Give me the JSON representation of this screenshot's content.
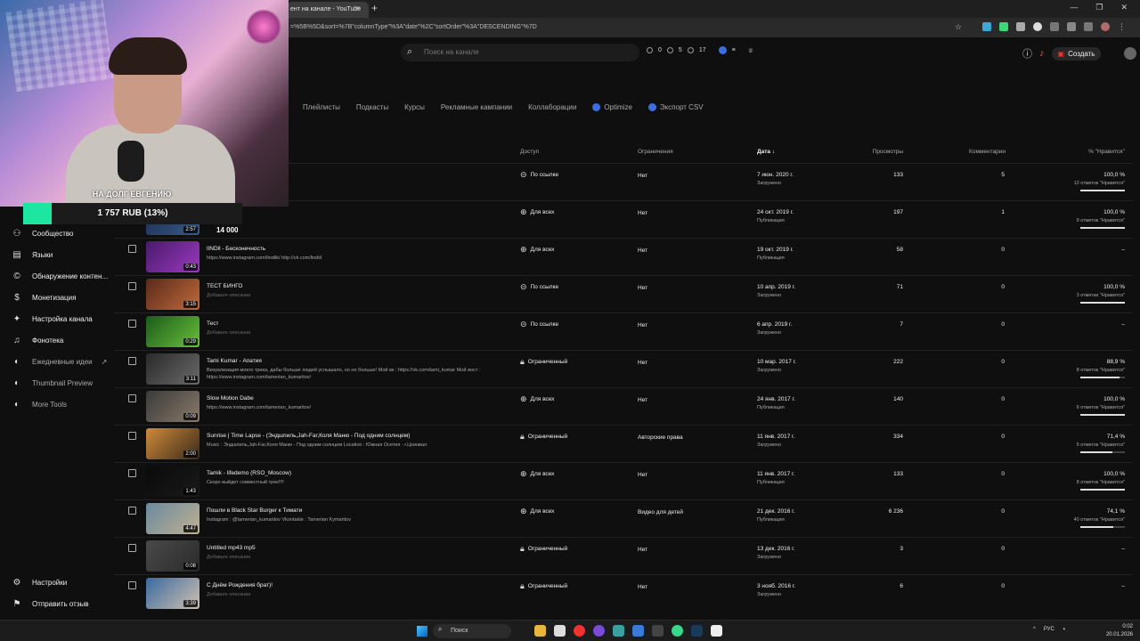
{
  "browser": {
    "tab_title": "ент на канале - YouTube",
    "tab_close": "×",
    "new_tab": "+",
    "url": "=%5B%5D&sort=%7B\"columnType\"%3A\"date\"%2C\"sortOrder\"%3A\"DESCENDING\"%7D"
  },
  "header": {
    "search_placeholder": "Поиск на канале",
    "stats": [
      "0",
      "5",
      "17"
    ],
    "create_label": "Создать"
  },
  "tabs": [
    {
      "label": "Плейлисты"
    },
    {
      "label": "Подкасты"
    },
    {
      "label": "Курсы"
    },
    {
      "label": "Рекламные кампании"
    },
    {
      "label": "Коллаборации"
    },
    {
      "label": "Optimize"
    },
    {
      "label": "Экспорт CSV"
    }
  ],
  "sidebar": {
    "items": [
      {
        "label": "Сообщество",
        "icon": "community-icon"
      },
      {
        "label": "Языки",
        "icon": "subtitles-icon"
      },
      {
        "label": "Обнаружение контен...",
        "icon": "copyright-icon"
      },
      {
        "label": "Монетизация",
        "icon": "dollar-icon"
      },
      {
        "label": "Настройка канала",
        "icon": "magic-wand-icon"
      },
      {
        "label": "Фонотека",
        "icon": "music-library-icon"
      },
      {
        "label": "Ежедневные идеи",
        "icon": "ideas-icon"
      },
      {
        "label": "Thumbnail Preview",
        "icon": "thumbnail-icon"
      },
      {
        "label": "More Tools",
        "icon": "tools-icon"
      }
    ],
    "settings_label": "Настройки",
    "feedback_label": "Отправить отзыв"
  },
  "table": {
    "headers": {
      "access": "Доступ",
      "restrictions": "Ограничения",
      "date": "Дата",
      "views": "Просмотры",
      "comments": "Комментарии",
      "likes": "% \"Нравится\""
    },
    "rows": [
      {
        "title": "",
        "desc": "",
        "desc_ph": false,
        "duration": "",
        "access": "По ссылке",
        "access_icon": "link",
        "restriction": "Нет",
        "date": "7 июн. 2020 г.",
        "date_sub": "Загружено",
        "views": "133",
        "comments": "5",
        "likes": "100,0 %",
        "likes_sub": "12 отметок \"Нравится\"",
        "likes_pct": 100,
        "thumb": [
          "#333",
          "#555"
        ]
      },
      {
        "title": "",
        "desc": "",
        "desc_ph": false,
        "duration": "2:57",
        "access": "Для всех",
        "access_icon": "globe",
        "restriction": "Нет",
        "date": "24 окт. 2019 г.",
        "date_sub": "Публикация",
        "views": "197",
        "comments": "1",
        "likes": "100,0 %",
        "likes_sub": "9 отметок \"Нравится\"",
        "likes_pct": 100,
        "thumb": [
          "#1a2a4a",
          "#3a5a8a"
        ]
      },
      {
        "title": "lINDll - Бесконечность",
        "desc": "https://www.instagram.com/lindilk/ http://vk.com/lindiil",
        "desc_ph": false,
        "duration": "0:43",
        "access": "Для всех",
        "access_icon": "globe",
        "restriction": "Нет",
        "date": "19 окт. 2019 г.",
        "date_sub": "Публикация",
        "views": "58",
        "comments": "0",
        "likes": "–",
        "likes_sub": "",
        "likes_pct": null,
        "thumb": [
          "#4a1a6a",
          "#9a3ac0"
        ]
      },
      {
        "title": "ТЕСТ БИНГО",
        "desc": "Добавьте описание",
        "desc_ph": true,
        "duration": "3:15",
        "access": "По ссылке",
        "access_icon": "link",
        "restriction": "Нет",
        "date": "10 апр. 2019 г.",
        "date_sub": "Загружено",
        "views": "71",
        "comments": "0",
        "likes": "100,0 %",
        "likes_sub": "3 отметки \"Нравится\"",
        "likes_pct": 100,
        "thumb": [
          "#5a2a1a",
          "#c06a3a"
        ]
      },
      {
        "title": "Тест",
        "desc": "Добавьте описание",
        "desc_ph": true,
        "duration": "0:29",
        "access": "По ссылке",
        "access_icon": "link",
        "restriction": "Нет",
        "date": "6 апр. 2019 г.",
        "date_sub": "Загружено",
        "views": "7",
        "comments": "0",
        "likes": "–",
        "likes_sub": "",
        "likes_pct": null,
        "thumb": [
          "#1a5a1a",
          "#6ac03a"
        ]
      },
      {
        "title": "Tami Kumar - Апатия",
        "desc": "Визуализация моего трека, дабы больше людей услышало, но не больше! Мой вк : https://vk.com/tami_kumar Мой инст : https://www.instagram.com/tamerian_kumaritov/",
        "desc_ph": false,
        "duration": "3:11",
        "access": "Ограниченный",
        "access_icon": "lock",
        "restriction": "Нет",
        "date": "10 мар. 2017 г.",
        "date_sub": "Загружено",
        "views": "222",
        "comments": "0",
        "likes": "88,9 %",
        "likes_sub": "8 отметок \"Нравится\"",
        "likes_pct": 88.9,
        "thumb": [
          "#2a2a2a",
          "#6a6a6a"
        ]
      },
      {
        "title": "Slow Motion Dabe",
        "desc": "https://www.instagram.com/tamerian_kumaritov/",
        "desc_ph": false,
        "duration": "0:09",
        "access": "Для всех",
        "access_icon": "globe",
        "restriction": "Нет",
        "date": "24 янв. 2017 г.",
        "date_sub": "Публикация",
        "views": "140",
        "comments": "0",
        "likes": "100,0 %",
        "likes_sub": "6 отметок \"Нравится\"",
        "likes_pct": 100,
        "thumb": [
          "#3a3a3a",
          "#8a7a6a"
        ]
      },
      {
        "title": "Sunrise | Time Lapse - (Эндшпиль,Jah-Far,Коля Маню - Под одним солнцем)",
        "desc": "Music : Эндшпиль,Jah-Far,Коля Маню - Под одним солнцем Location : Южная Осетия - г.Цхинвал",
        "desc_ph": false,
        "duration": "2:00",
        "access": "Ограниченный",
        "access_icon": "lock",
        "restriction": "Авторские права",
        "date": "11 янв. 2017 г.",
        "date_sub": "Загружено",
        "views": "334",
        "comments": "0",
        "likes": "71,4 %",
        "likes_sub": "5 отметок \"Нравится\"",
        "likes_pct": 71.4,
        "thumb": [
          "#d08a3a",
          "#3a2a1a"
        ]
      },
      {
        "title": "Tamik - lifedemo (RSO_Moscow)",
        "desc": "Скоро выйдет совместный трек!!!!",
        "desc_ph": false,
        "duration": "1:43",
        "access": "Для всех",
        "access_icon": "globe",
        "restriction": "Нет",
        "date": "11 янв. 2017 г.",
        "date_sub": "Публикация",
        "views": "133",
        "comments": "0",
        "likes": "100,0 %",
        "likes_sub": "8 отметок \"Нравится\"",
        "likes_pct": 100,
        "thumb": [
          "#0a0a0a",
          "#1a1a1a"
        ]
      },
      {
        "title": "Пошли в Black Star Burger к Тимати",
        "desc": "Instagram : @tamerian_kumaritov Vkontakte : Tamerian Kymaritov",
        "desc_ph": false,
        "duration": "4:47",
        "access": "Для всех",
        "access_icon": "globe",
        "restriction": "Видео для детей",
        "date": "21 дек. 2016 г.",
        "date_sub": "Публикация",
        "views": "6 236",
        "comments": "0",
        "likes": "74,1 %",
        "likes_sub": "40 отметок \"Нравится\"",
        "likes_pct": 74.1,
        "thumb": [
          "#6a8aa0",
          "#c0b090"
        ]
      },
      {
        "title": "Untitled mp43 mp5",
        "desc": "Добавьте описание",
        "desc_ph": true,
        "duration": "0:08",
        "access": "Ограниченный",
        "access_icon": "lock",
        "restriction": "Нет",
        "date": "13 дек. 2016 г.",
        "date_sub": "Загружено",
        "views": "3",
        "comments": "0",
        "likes": "–",
        "likes_sub": "",
        "likes_pct": null,
        "thumb": [
          "#4a4a4a",
          "#2a2a2a"
        ]
      },
      {
        "title": "С Днём Рождения брат)!",
        "desc": "Добавьте описание",
        "desc_ph": true,
        "duration": "3:39",
        "access": "Ограниченный",
        "access_icon": "lock",
        "restriction": "Нет",
        "date": "3 нояб. 2016 г.",
        "date_sub": "Загружено",
        "views": "6",
        "comments": "0",
        "likes": "–",
        "likes_sub": "",
        "likes_pct": null,
        "thumb": [
          "#3a6aa0",
          "#d0c0b0"
        ]
      }
    ]
  },
  "overlay": {
    "donation_text": "НА ДОЛГ ЕВГЕНИЮ",
    "donation_amount": "1 757 RUB (13%)",
    "donation_progress": 13,
    "goal": "14 000",
    "green_indicator": "#1de6a0"
  },
  "taskbar": {
    "search_label": "Поиск",
    "lang": "РУС",
    "time": "0:02",
    "date": "20.01.2026"
  },
  "colors": {
    "background": "#0f0f0f",
    "accent_blue": "#3b6fe0"
  }
}
